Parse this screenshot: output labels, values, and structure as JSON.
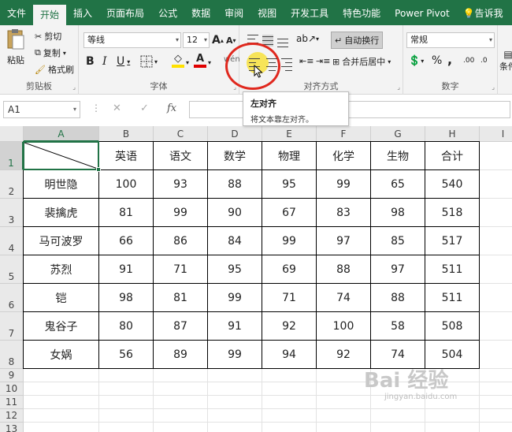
{
  "ribbon_tabs": [
    "文件",
    "开始",
    "插入",
    "页面布局",
    "公式",
    "数据",
    "审阅",
    "视图",
    "开发工具",
    "特色功能",
    "Power Pivot"
  ],
  "tell_me": "告诉我",
  "clipboard": {
    "paste": "粘贴",
    "cut": "剪切",
    "copy": "复制",
    "format_painter": "格式刷",
    "group": "剪贴板"
  },
  "font": {
    "name": "等线",
    "size": "12",
    "bold": "B",
    "italic": "I",
    "underline": "U",
    "grow": "A",
    "shrink": "A",
    "font_color_glyph": "A",
    "group": "字体"
  },
  "alignment": {
    "wrap_text": "自动换行",
    "merge_center": "合并后居中",
    "group": "对齐方式"
  },
  "number": {
    "format": "常规",
    "percent": "%",
    "comma": ",",
    "increase_decimal": ".00",
    "decrease_decimal": ".0",
    "group": "数字"
  },
  "styles_partial": "条件",
  "name_box": "A1",
  "formula_symbols": {
    "cancel": "✕",
    "enter": "✓",
    "fx": "fx"
  },
  "tooltip": {
    "title": "左对齐",
    "description": "将文本靠左对齐。"
  },
  "columns": [
    "A",
    "B",
    "C",
    "D",
    "E",
    "F",
    "G",
    "H",
    "I"
  ],
  "rows": [
    "1",
    "2",
    "3",
    "4",
    "5",
    "6",
    "7",
    "8",
    "9",
    "10",
    "11",
    "12",
    "13"
  ],
  "table": {
    "header": [
      "",
      "英语",
      "语文",
      "数学",
      "物理",
      "化学",
      "生物",
      "合计"
    ],
    "data": [
      [
        "明世隐",
        "100",
        "93",
        "88",
        "95",
        "99",
        "65",
        "540"
      ],
      [
        "裴擒虎",
        "81",
        "99",
        "90",
        "67",
        "83",
        "98",
        "518"
      ],
      [
        "马可波罗",
        "66",
        "86",
        "84",
        "99",
        "97",
        "85",
        "517"
      ],
      [
        "苏烈",
        "91",
        "71",
        "95",
        "69",
        "88",
        "97",
        "511"
      ],
      [
        "铠",
        "98",
        "81",
        "99",
        "71",
        "74",
        "88",
        "511"
      ],
      [
        "鬼谷子",
        "80",
        "87",
        "91",
        "92",
        "100",
        "58",
        "508"
      ],
      [
        "女娲",
        "56",
        "89",
        "99",
        "94",
        "92",
        "74",
        "504"
      ]
    ]
  },
  "watermark": {
    "brand": "Bai 经验",
    "url": "jingyan.baidu.com"
  },
  "colors": {
    "ribbon_green": "#217346",
    "highlight_red": "#e0281e",
    "cursor_yellow": "#f7e13c",
    "fill_yellow": "#ffe100",
    "font_red": "#e00000"
  }
}
